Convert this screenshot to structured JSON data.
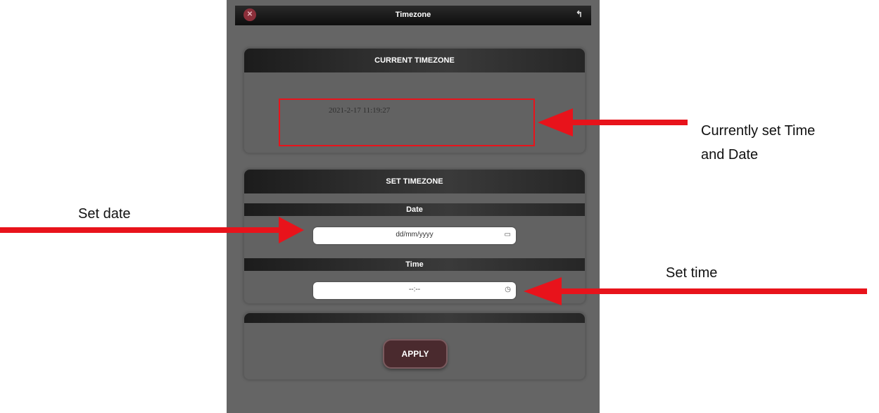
{
  "window": {
    "title": "Timezone"
  },
  "current_section": {
    "header": "CURRENT TIMEZONE",
    "value": "2021-2-17 11:19:27"
  },
  "set_section": {
    "header": "SET TIMEZONE",
    "date_label": "Date",
    "date_value": "dd/mm/yyyy",
    "time_label": "Time",
    "time_value": "--:--"
  },
  "apply_label": "APPLY",
  "annotations": {
    "current_line1": "Currently set Time",
    "current_line2": "and Date",
    "set_date": "Set date",
    "set_time": "Set time"
  },
  "colors": {
    "annotation_red": "#e8131b",
    "panel_gray": "#656565"
  }
}
